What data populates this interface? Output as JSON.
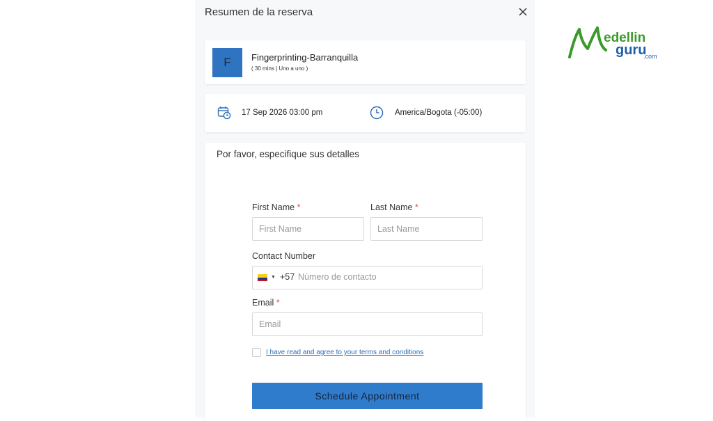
{
  "header": {
    "title": "Resumen de la reserva"
  },
  "service": {
    "avatar_letter": "F",
    "name": "Fingerprinting-Barranquilla",
    "meta": "( 30 mins | Uno a uno )"
  },
  "schedule": {
    "datetime": "17 Sep 2026  03:00 pm",
    "timezone": "America/Bogota (-05:00)"
  },
  "form": {
    "heading": "Por favor, especifique sus detalles",
    "first_name": {
      "label": "First Name",
      "required_mark": "*",
      "placeholder": "First Name"
    },
    "last_name": {
      "label": "Last Name",
      "required_mark": "*",
      "placeholder": "Last Name"
    },
    "contact": {
      "label": "Contact Number",
      "dial_code": "+57",
      "placeholder": "Número de contacto"
    },
    "email": {
      "label": "Email",
      "required_mark": "*",
      "placeholder": "Email"
    },
    "terms": {
      "label": "I have read and agree to your terms and conditions",
      "checked": false
    },
    "submit_label": "Schedule Appointment"
  },
  "logo": {
    "text_main": "edellin",
    "text_guru": "guru",
    "text_com": ".com"
  },
  "colors": {
    "accent": "#2f7bcc",
    "avatar_bg": "#2f74c0",
    "required": "#d9534f",
    "logo_green": "#3a9a2a",
    "logo_blue": "#1f5fa8"
  }
}
